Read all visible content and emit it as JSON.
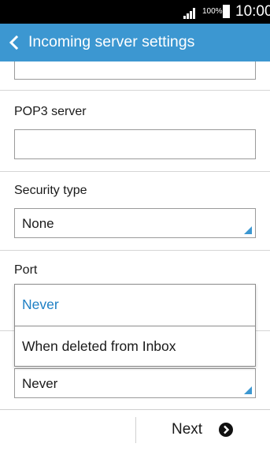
{
  "status_bar": {
    "battery_percent": "100%",
    "time": "10:00",
    "icons": [
      "signal-icon",
      "battery-icon"
    ]
  },
  "app_bar": {
    "title": "Incoming server settings",
    "back_icon": "chevron-left-icon",
    "color": "#3c97d1"
  },
  "form": {
    "username_value": "",
    "pop3_server_label": "POP3 server",
    "pop3_server_value": "",
    "security_type_label": "Security type",
    "security_type_value": "None",
    "port_label": "Port",
    "delete_email_value": "Never"
  },
  "dropdown_popup": {
    "options": [
      {
        "label": "Never",
        "selected": true
      },
      {
        "label": "When deleted from Inbox",
        "selected": false
      }
    ],
    "selected_color": "#1d7fc4"
  },
  "bottom_bar": {
    "next_label": "Next",
    "next_icon": "arrow-circle-right-icon"
  }
}
